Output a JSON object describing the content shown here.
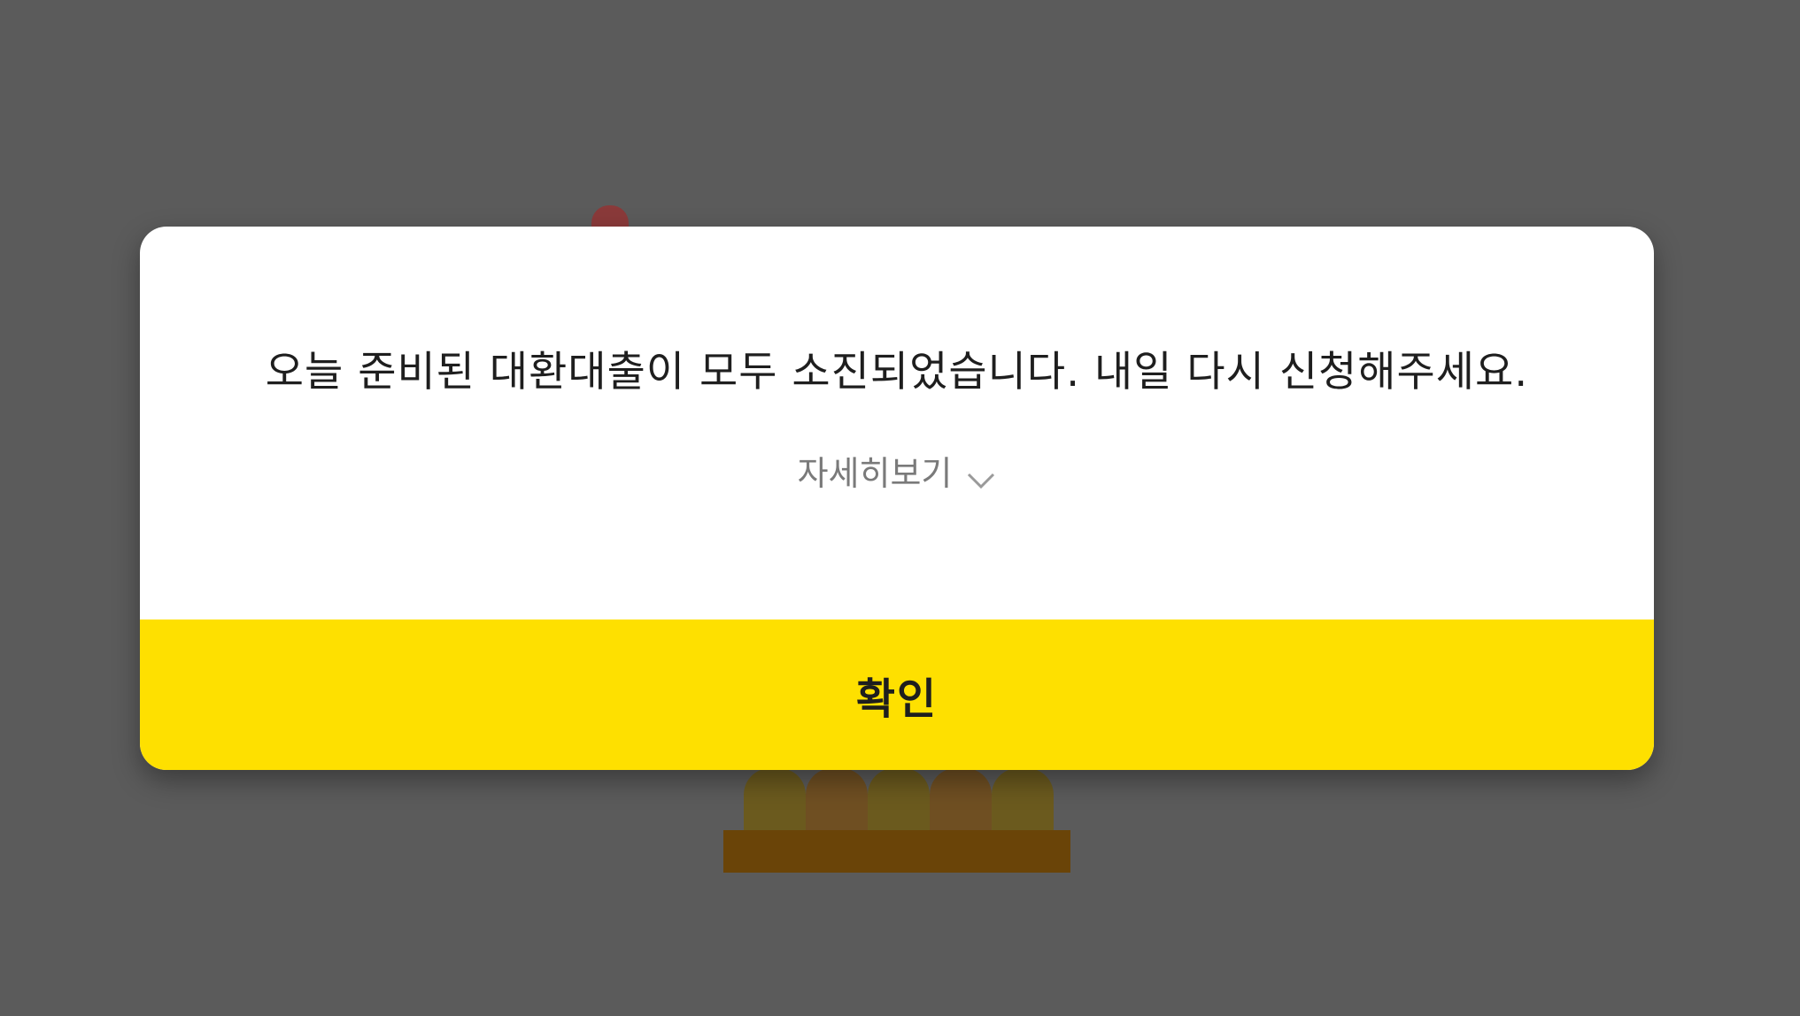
{
  "dialog": {
    "message": "오늘 준비된 대환대출이 모두 소진되었습니다. 내일 다시 신청해주세요.",
    "details_label": "자세히보기",
    "details_icon": "chevron-down-icon",
    "confirm_label": "확인"
  },
  "colors": {
    "overlay_background": "#5b5b5b",
    "dialog_background": "#ffffff",
    "confirm_button": "#fee000",
    "message_text": "#1e1e1e",
    "details_text": "#7a7a7a"
  }
}
